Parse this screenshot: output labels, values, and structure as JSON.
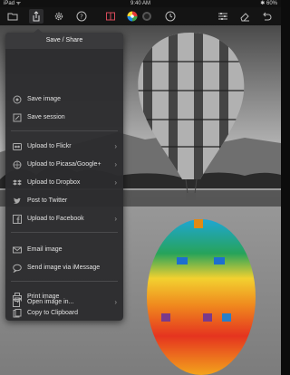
{
  "status_bar": {
    "carrier": "iPad ᯤ",
    "time": "9:40 AM",
    "battery": "✱ 60%"
  },
  "toolbar": {
    "left_icons": [
      "folder-icon",
      "share-icon",
      "gear-icon",
      "help-icon",
      "compare-icon",
      "color-wheel-icon",
      "toggle-icon",
      "history-icon"
    ],
    "right_icons": [
      "sliders-icon",
      "eraser-icon",
      "undo-icon"
    ],
    "active_color": "#4a90e2"
  },
  "popover": {
    "title": "Save / Share",
    "items": [
      {
        "label": "Save image",
        "icon": "save-image-icon",
        "chevron": ""
      },
      {
        "label": "Save session",
        "icon": "save-session-icon",
        "chevron": ""
      },
      {
        "label": "Upload to Flickr",
        "icon": "flickr-icon",
        "chevron": "›"
      },
      {
        "label": "Upload to Picasa/Google+",
        "icon": "picasa-icon",
        "chevron": "›"
      },
      {
        "label": "Upload to Dropbox",
        "icon": "dropbox-icon",
        "chevron": "›"
      },
      {
        "label": "Post to Twitter",
        "icon": "twitter-icon",
        "chevron": ""
      },
      {
        "label": "Upload to Facebook",
        "icon": "facebook-icon",
        "chevron": "›"
      },
      {
        "label": "Email image",
        "icon": "email-icon",
        "chevron": ""
      },
      {
        "label": "Send image via iMessage",
        "icon": "imessage-icon",
        "chevron": ""
      },
      {
        "label": "Print image",
        "icon": "print-icon",
        "chevron": ""
      },
      {
        "label": "Copy to Clipboard",
        "icon": "clipboard-icon",
        "chevron": ""
      },
      {
        "label": "Open image in...",
        "icon": "open-in-icon",
        "chevron": "›"
      }
    ]
  }
}
